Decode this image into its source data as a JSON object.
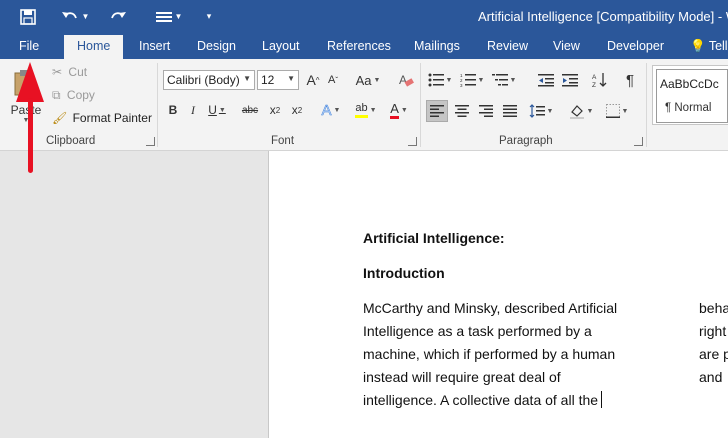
{
  "titlebar": {
    "title": "Artificial Intelligence [Compatibility Mode] - W",
    "icons": [
      "save-icon",
      "undo-icon",
      "redo-icon",
      "touch-mode-icon",
      "customize-qat-icon"
    ]
  },
  "tabs": {
    "file": "File",
    "home": "Home",
    "insert": "Insert",
    "design": "Design",
    "layout": "Layout",
    "references": "References",
    "mailings": "Mailings",
    "review": "Review",
    "view": "View",
    "developer": "Developer",
    "tell": "Tell"
  },
  "clipboard": {
    "paste": "Paste",
    "cut": "Cut",
    "copy": "Copy",
    "format_painter": "Format Painter",
    "label": "Clipboard"
  },
  "font": {
    "family": "Calibri (Body)",
    "size": "12",
    "label": "Font",
    "grow": "A",
    "shrink": "A",
    "change_case": "Aa",
    "bold": "B",
    "italic": "I",
    "underline": "U",
    "strike": "abc",
    "subscript": "x",
    "superscript": "x",
    "text_effects": "A",
    "highlight": "ab",
    "font_color": "A"
  },
  "paragraph": {
    "label": "Paragraph",
    "show_marks": "¶"
  },
  "styles": {
    "preview": "AaBbCcDc",
    "normal": "¶ Normal"
  },
  "document": {
    "heading1": "Artificial Intelligence:",
    "heading2": "Introduction",
    "col1": [
      "McCarthy and Minsky, described Artificial",
      "Intelligence as a task performed by a",
      "machine, which if performed by a human",
      "instead will require great deal of",
      "intelligence. A collective data of all the"
    ],
    "col2": [
      "beha",
      "right",
      "are p",
      "and"
    ]
  },
  "colors": {
    "accent": "#2b579a",
    "arrow": "#e81123",
    "highlight": "#ffff00",
    "font_color": "#e81123"
  }
}
